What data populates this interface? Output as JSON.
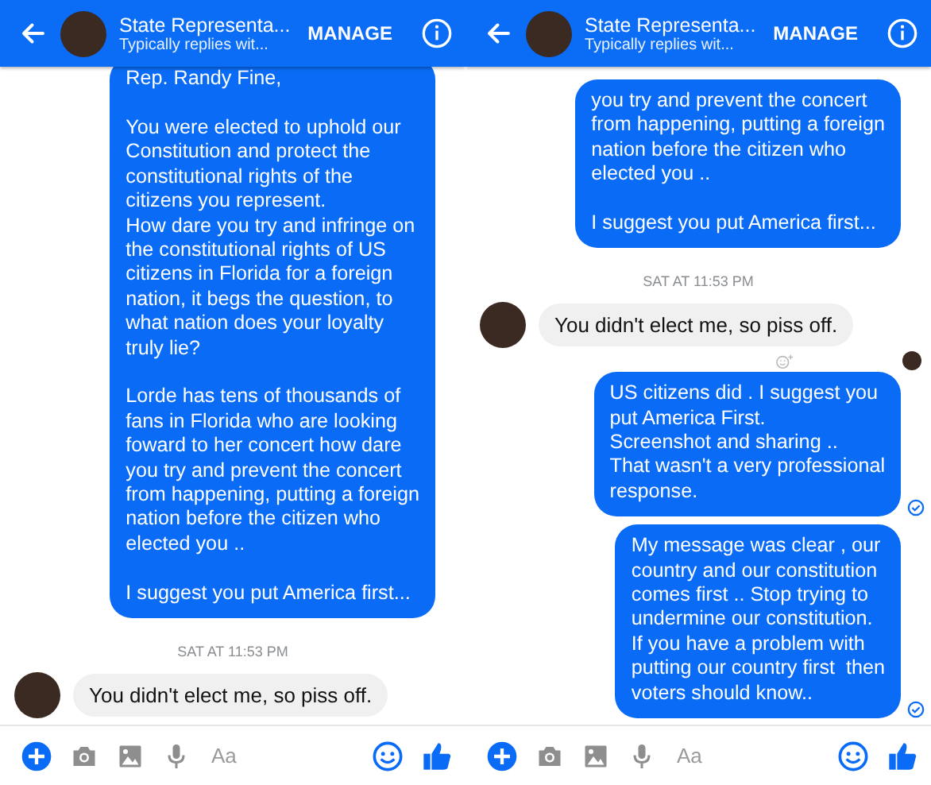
{
  "panels": [
    {
      "header": {
        "title": "State Representa...",
        "subtitle": "Typically replies wit...",
        "action": "MANAGE"
      },
      "messages": [
        {
          "kind": "outgoing",
          "text": "Rep. Randy Fine,\n\nYou were elected to uphold our\nConstitution and protect the\nconstitutional rights of the\ncitizens you represent.\nHow dare you try and infringe on\nthe constitutional rights of US\ncitizens in Florida for a foreign\nnation, it begs the question, to\nwhat nation does your loyalty\ntruly lie?\n\nLorde has tens of thousands of\nfans in Florida who are looking\nfoward to her concert how dare\nyou try and prevent the concert\nfrom happening, putting a foreign\nnation before the citizen who\nelected you ..\n\nI suggest you put America first...",
          "delivered": false
        },
        {
          "kind": "timestamp",
          "text": "SAT AT 11:53 PM"
        },
        {
          "kind": "incoming",
          "text": "You didn't elect me, so piss off.",
          "reaction_button": false,
          "seen_marker": false
        }
      ],
      "composer": {
        "placeholder": "Aa"
      }
    },
    {
      "header": {
        "title": "State Representa...",
        "subtitle": "Typically replies wit...",
        "action": "MANAGE"
      },
      "messages": [
        {
          "kind": "outgoing",
          "text": "you try and prevent the concert\nfrom happening, putting a foreign\nnation before the citizen who\nelected you ..\n\nI suggest you put America first...",
          "delivered": false
        },
        {
          "kind": "timestamp",
          "text": "SAT AT 11:53 PM"
        },
        {
          "kind": "incoming",
          "text": "You didn't elect me, so piss off.",
          "reaction_button": true,
          "seen_marker": true
        },
        {
          "kind": "outgoing",
          "text": "US citizens did . I suggest you\nput America First.\nScreenshot and sharing ..\nThat wasn't a very professional\nresponse.",
          "delivered": true
        },
        {
          "kind": "outgoing",
          "text": "My message was clear , our\ncountry and our constitution\ncomes first .. Stop trying to\nundermine our constitution.\nIf you have a problem with\nputting our country first  then\nvoters should know..",
          "delivered": true
        }
      ],
      "composer": {
        "placeholder": "Aa"
      }
    }
  ]
}
